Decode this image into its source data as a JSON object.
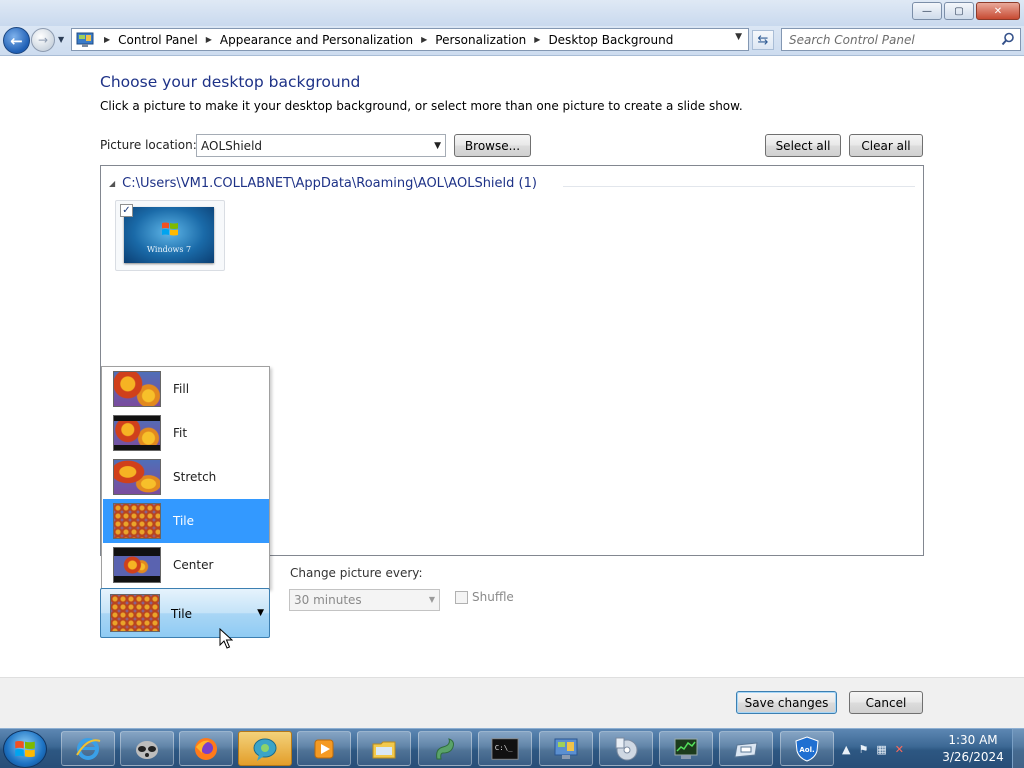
{
  "window": {
    "controls": {
      "minimize": "—",
      "maximize": "▢",
      "close": "✕"
    }
  },
  "nav": {
    "back_glyph": "←",
    "forward_glyph": "→",
    "breadcrumbs": [
      "Control Panel",
      "Appearance and Personalization",
      "Personalization",
      "Desktop Background"
    ],
    "search_placeholder": "Search Control Panel"
  },
  "page": {
    "title": "Choose your desktop background",
    "subtitle": "Click a picture to make it your desktop background, or select more than one picture to create a slide show."
  },
  "location": {
    "label": "Picture location:",
    "value": "AOLShield",
    "browse_label": "Browse...",
    "select_all_label": "Select all",
    "clear_all_label": "Clear all"
  },
  "gallery": {
    "group_title": "C:\\Users\\VM1.COLLABNET\\AppData\\Roaming\\AOL\\AOLShield (1)",
    "items": [
      {
        "caption": "Windows 7",
        "checked": true,
        "check_glyph": "✓"
      }
    ]
  },
  "position": {
    "options": [
      "Fill",
      "Fit",
      "Stretch",
      "Tile",
      "Center"
    ],
    "selected": "Tile"
  },
  "slideshow": {
    "label": "Change picture every:",
    "interval": "30 minutes",
    "shuffle_label": "Shuffle",
    "shuffle_checked": false
  },
  "footer": {
    "save_label": "Save changes",
    "cancel_label": "Cancel"
  },
  "taskbar": {
    "apps": [
      "internet-explorer-icon",
      "raccoon-icon",
      "firefox-icon",
      "chat-icon",
      "media-player-icon",
      "file-explorer-icon",
      "snake-icon",
      "command-prompt-icon",
      "control-panel-icon",
      "disc-tools-icon",
      "system-monitor-icon",
      "drive-icon",
      "aol-shield-icon"
    ],
    "cmd_text": "C:\\_",
    "aol_text": "Aol."
  },
  "clock": {
    "time": "1:30 AM",
    "date": "3/26/2024"
  },
  "colors": {
    "title_blue": "#1e3287",
    "selection_blue": "#3399ff",
    "taskbar": "#2d5782"
  }
}
